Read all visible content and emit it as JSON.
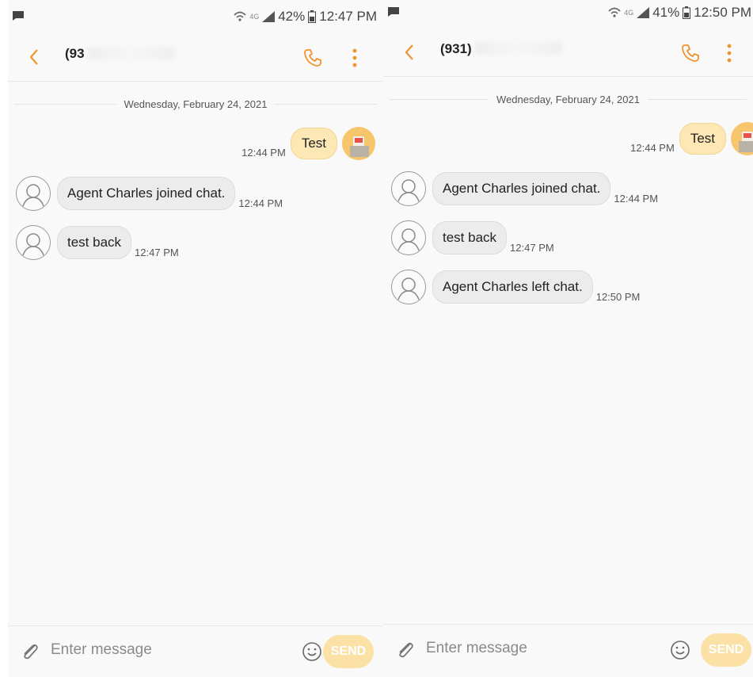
{
  "colors": {
    "accent": "#f0942f",
    "outgoing_bubble": "#fde8b5",
    "incoming_bubble": "#ececec",
    "send_button": "#fce1a6"
  },
  "screens": [
    {
      "status": {
        "battery": "42%",
        "time": "12:47 PM"
      },
      "header": {
        "contact_visible": "(93",
        "contact_redacted": "redacted"
      },
      "date_divider": "Wednesday, February 24, 2021",
      "outgoing": [
        {
          "text": "Test",
          "time": "12:44 PM"
        }
      ],
      "incoming": [
        {
          "text": "Agent Charles joined chat.",
          "time": "12:44 PM"
        },
        {
          "text": "test back",
          "time": "12:47 PM"
        }
      ],
      "composer": {
        "placeholder": "Enter message",
        "send_label": "SEND"
      }
    },
    {
      "status": {
        "battery": "41%",
        "time": "12:50 PM"
      },
      "header": {
        "contact_visible": "(931)",
        "contact_redacted": "redacted"
      },
      "date_divider": "Wednesday, February 24, 2021",
      "outgoing": [
        {
          "text": "Test",
          "time": "12:44 PM"
        }
      ],
      "incoming": [
        {
          "text": "Agent Charles joined chat.",
          "time": "12:44 PM"
        },
        {
          "text": "test back",
          "time": "12:47 PM"
        },
        {
          "text": "Agent Charles left chat.",
          "time": "12:50 PM"
        }
      ],
      "composer": {
        "placeholder": "Enter message",
        "send_label": "SEND"
      }
    }
  ]
}
